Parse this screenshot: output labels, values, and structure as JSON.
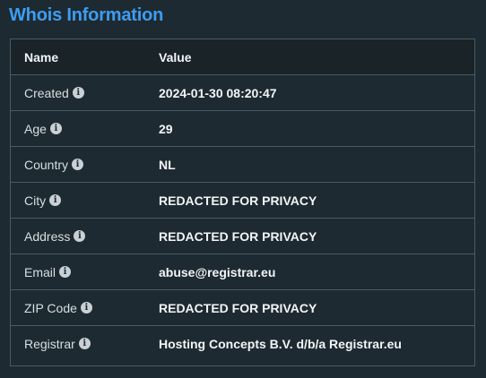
{
  "title": "Whois Information",
  "table": {
    "headers": {
      "name": "Name",
      "value": "Value"
    },
    "info_icon_glyph": "i",
    "rows": [
      {
        "name": "Created",
        "value": "2024-01-30 08:20:47"
      },
      {
        "name": "Age",
        "value": "29"
      },
      {
        "name": "Country",
        "value": "NL"
      },
      {
        "name": "City",
        "value": "REDACTED FOR PRIVACY"
      },
      {
        "name": "Address",
        "value": "REDACTED FOR PRIVACY"
      },
      {
        "name": "Email",
        "value": "abuse@registrar.eu"
      },
      {
        "name": "ZIP Code",
        "value": "REDACTED FOR PRIVACY"
      },
      {
        "name": "Registrar",
        "value": "Hosting Concepts B.V. d/b/a Registrar.eu"
      }
    ]
  },
  "colors": {
    "background": "#1e2a31",
    "title": "#3d9df2",
    "border": "#4a5b64",
    "text": "#f2f5f7"
  }
}
